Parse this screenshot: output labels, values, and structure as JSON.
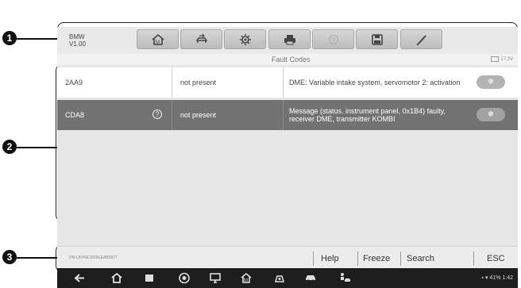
{
  "callouts": [
    "1",
    "2",
    "3"
  ],
  "toolbar": {
    "brand": "BMW",
    "version": "V1.00",
    "buttons": [
      "home-icon",
      "vehicle-swap-icon",
      "settings-icon",
      "print-icon",
      "help-icon",
      "save-icon",
      "data-logging-icon"
    ]
  },
  "screen_title": "Fault Codes",
  "battery_voltage": "17.3V",
  "codes": [
    {
      "code": "2AA9",
      "status": "not present",
      "description": "DME: Variable intake system, servomotor 2: activation",
      "selected": false
    },
    {
      "code": "CDA8",
      "status": "not present",
      "description": "Message (status. instrument panel, 0x1B4) faulty, receiver DME, transmitter KOMBI",
      "selected": true
    }
  ],
  "footer": {
    "vin": "VIN:LBVNE3905EEAB5877",
    "buttons": {
      "help": "Help",
      "freeze": "Freeze",
      "search": "Search",
      "esc": "ESC"
    }
  },
  "system_bar": {
    "status": "41%",
    "time": "1:42"
  },
  "colors": {
    "selected_row": "#727272",
    "freeze_frame_button": "#b3b3b3",
    "system_bar": "#1e1e1e"
  }
}
